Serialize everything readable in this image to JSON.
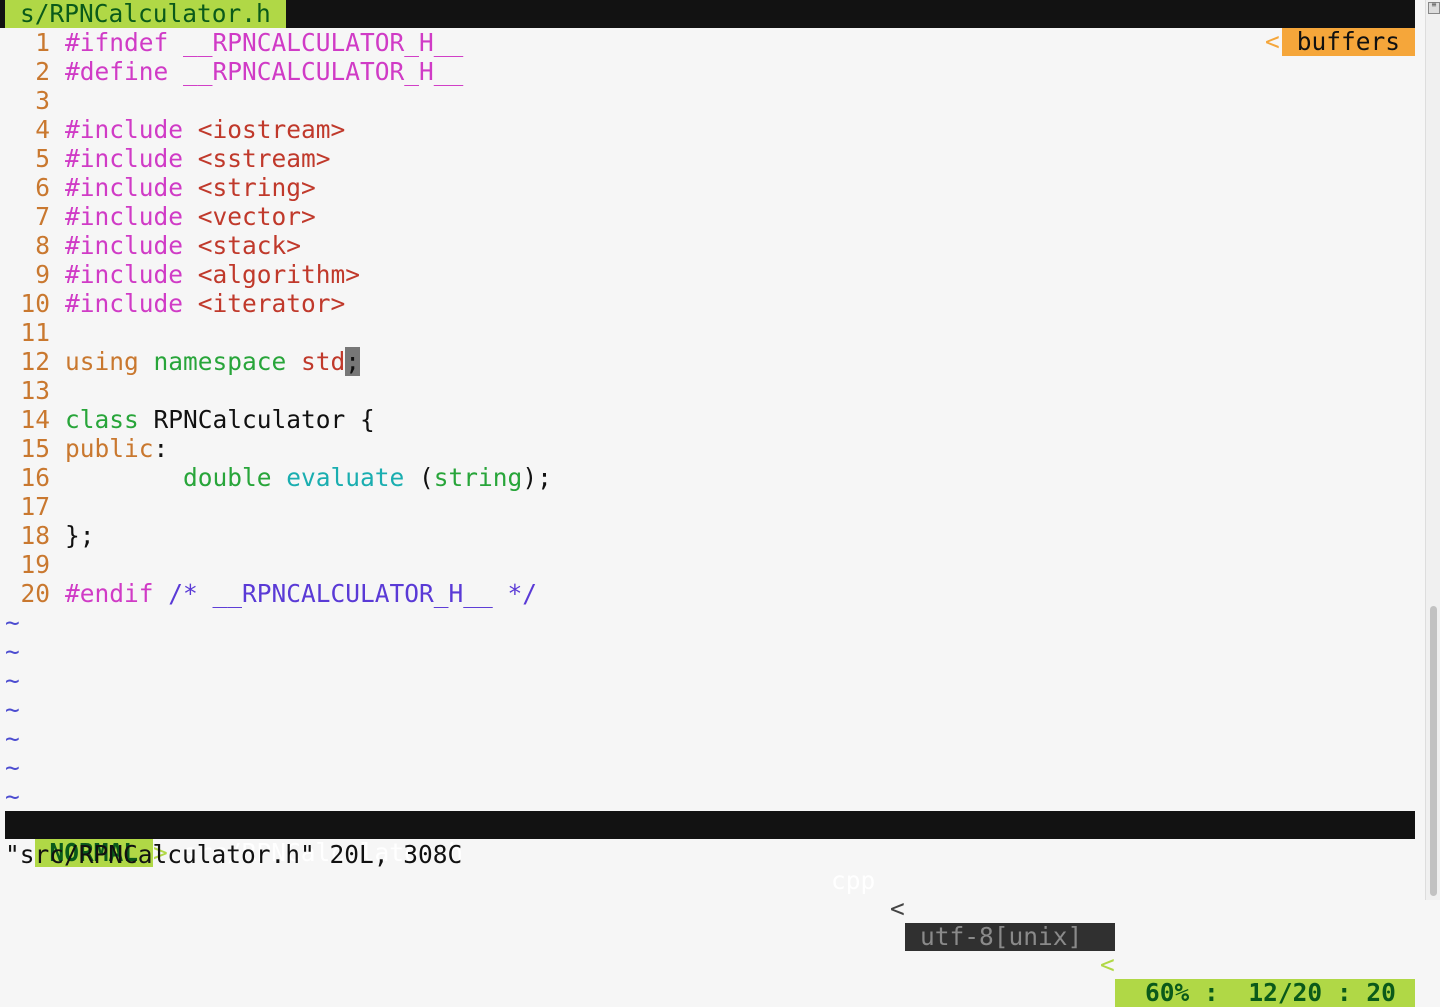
{
  "tabline": {
    "current": "s/RPNCalculator.h",
    "right_sep": "<",
    "right_label": "buffers"
  },
  "colors": {
    "linenr": "#c9782f",
    "preproc": "#d03bc6",
    "include": "#c0392b",
    "statement": "#c9782f",
    "type": "#28a53a",
    "ident": "#c0392b",
    "func": "#1aaeb0",
    "comment": "#5a3ad6",
    "normal": "#111111"
  },
  "lines": [
    {
      "n": "1",
      "tokens": [
        {
          "t": "#ifndef __RPNCALCULATOR_H__",
          "c": "preproc"
        }
      ]
    },
    {
      "n": "2",
      "tokens": [
        {
          "t": "#define __RPNCALCULATOR_H__",
          "c": "preproc"
        }
      ]
    },
    {
      "n": "3",
      "tokens": []
    },
    {
      "n": "4",
      "tokens": [
        {
          "t": "#include ",
          "c": "preproc"
        },
        {
          "t": "<iostream>",
          "c": "include"
        }
      ]
    },
    {
      "n": "5",
      "tokens": [
        {
          "t": "#include ",
          "c": "preproc"
        },
        {
          "t": "<sstream>",
          "c": "include"
        }
      ]
    },
    {
      "n": "6",
      "tokens": [
        {
          "t": "#include ",
          "c": "preproc"
        },
        {
          "t": "<string>",
          "c": "include"
        }
      ]
    },
    {
      "n": "7",
      "tokens": [
        {
          "t": "#include ",
          "c": "preproc"
        },
        {
          "t": "<vector>",
          "c": "include"
        }
      ]
    },
    {
      "n": "8",
      "tokens": [
        {
          "t": "#include ",
          "c": "preproc"
        },
        {
          "t": "<stack>",
          "c": "include"
        }
      ]
    },
    {
      "n": "9",
      "tokens": [
        {
          "t": "#include ",
          "c": "preproc"
        },
        {
          "t": "<algorithm>",
          "c": "include"
        }
      ]
    },
    {
      "n": "10",
      "tokens": [
        {
          "t": "#include ",
          "c": "preproc"
        },
        {
          "t": "<iterator>",
          "c": "include"
        }
      ]
    },
    {
      "n": "11",
      "tokens": []
    },
    {
      "n": "12",
      "tokens": [
        {
          "t": "using ",
          "c": "statement"
        },
        {
          "t": "namespace ",
          "c": "type"
        },
        {
          "t": "std",
          "c": "ident"
        },
        {
          "t": ";",
          "c": "cursor"
        }
      ]
    },
    {
      "n": "13",
      "tokens": []
    },
    {
      "n": "14",
      "tokens": [
        {
          "t": "class ",
          "c": "type"
        },
        {
          "t": "RPNCalculator {",
          "c": "normal"
        }
      ]
    },
    {
      "n": "15",
      "tokens": [
        {
          "t": "public",
          "c": "statement"
        },
        {
          "t": ":",
          "c": "normal"
        }
      ]
    },
    {
      "n": "16",
      "tokens": [
        {
          "t": "        double ",
          "c": "type"
        },
        {
          "t": "evaluate ",
          "c": "func"
        },
        {
          "t": "(",
          "c": "normal"
        },
        {
          "t": "string",
          "c": "type"
        },
        {
          "t": ");",
          "c": "normal"
        }
      ]
    },
    {
      "n": "17",
      "tokens": []
    },
    {
      "n": "18",
      "tokens": [
        {
          "t": "};",
          "c": "normal"
        }
      ]
    },
    {
      "n": "19",
      "tokens": []
    },
    {
      "n": "20",
      "tokens": [
        {
          "t": "#endif ",
          "c": "preproc"
        },
        {
          "t": "/* __RPNCALCULATOR_H__ */",
          "c": "comment"
        }
      ]
    }
  ],
  "tilde": "~",
  "statusline": {
    "mode": "NORMAL",
    "sep1": ">",
    "file": "src/RPNCalculator.h",
    "filetype": "cpp",
    "sep2": "<",
    "encoding": "utf-8[unix]",
    "sep3": "<",
    "percent": "60%",
    "colon1": ":",
    "position": "12/20",
    "colon2": ":",
    "column": "20"
  },
  "message": "\"src/RPNCalculator.h\" 20L, 308C"
}
